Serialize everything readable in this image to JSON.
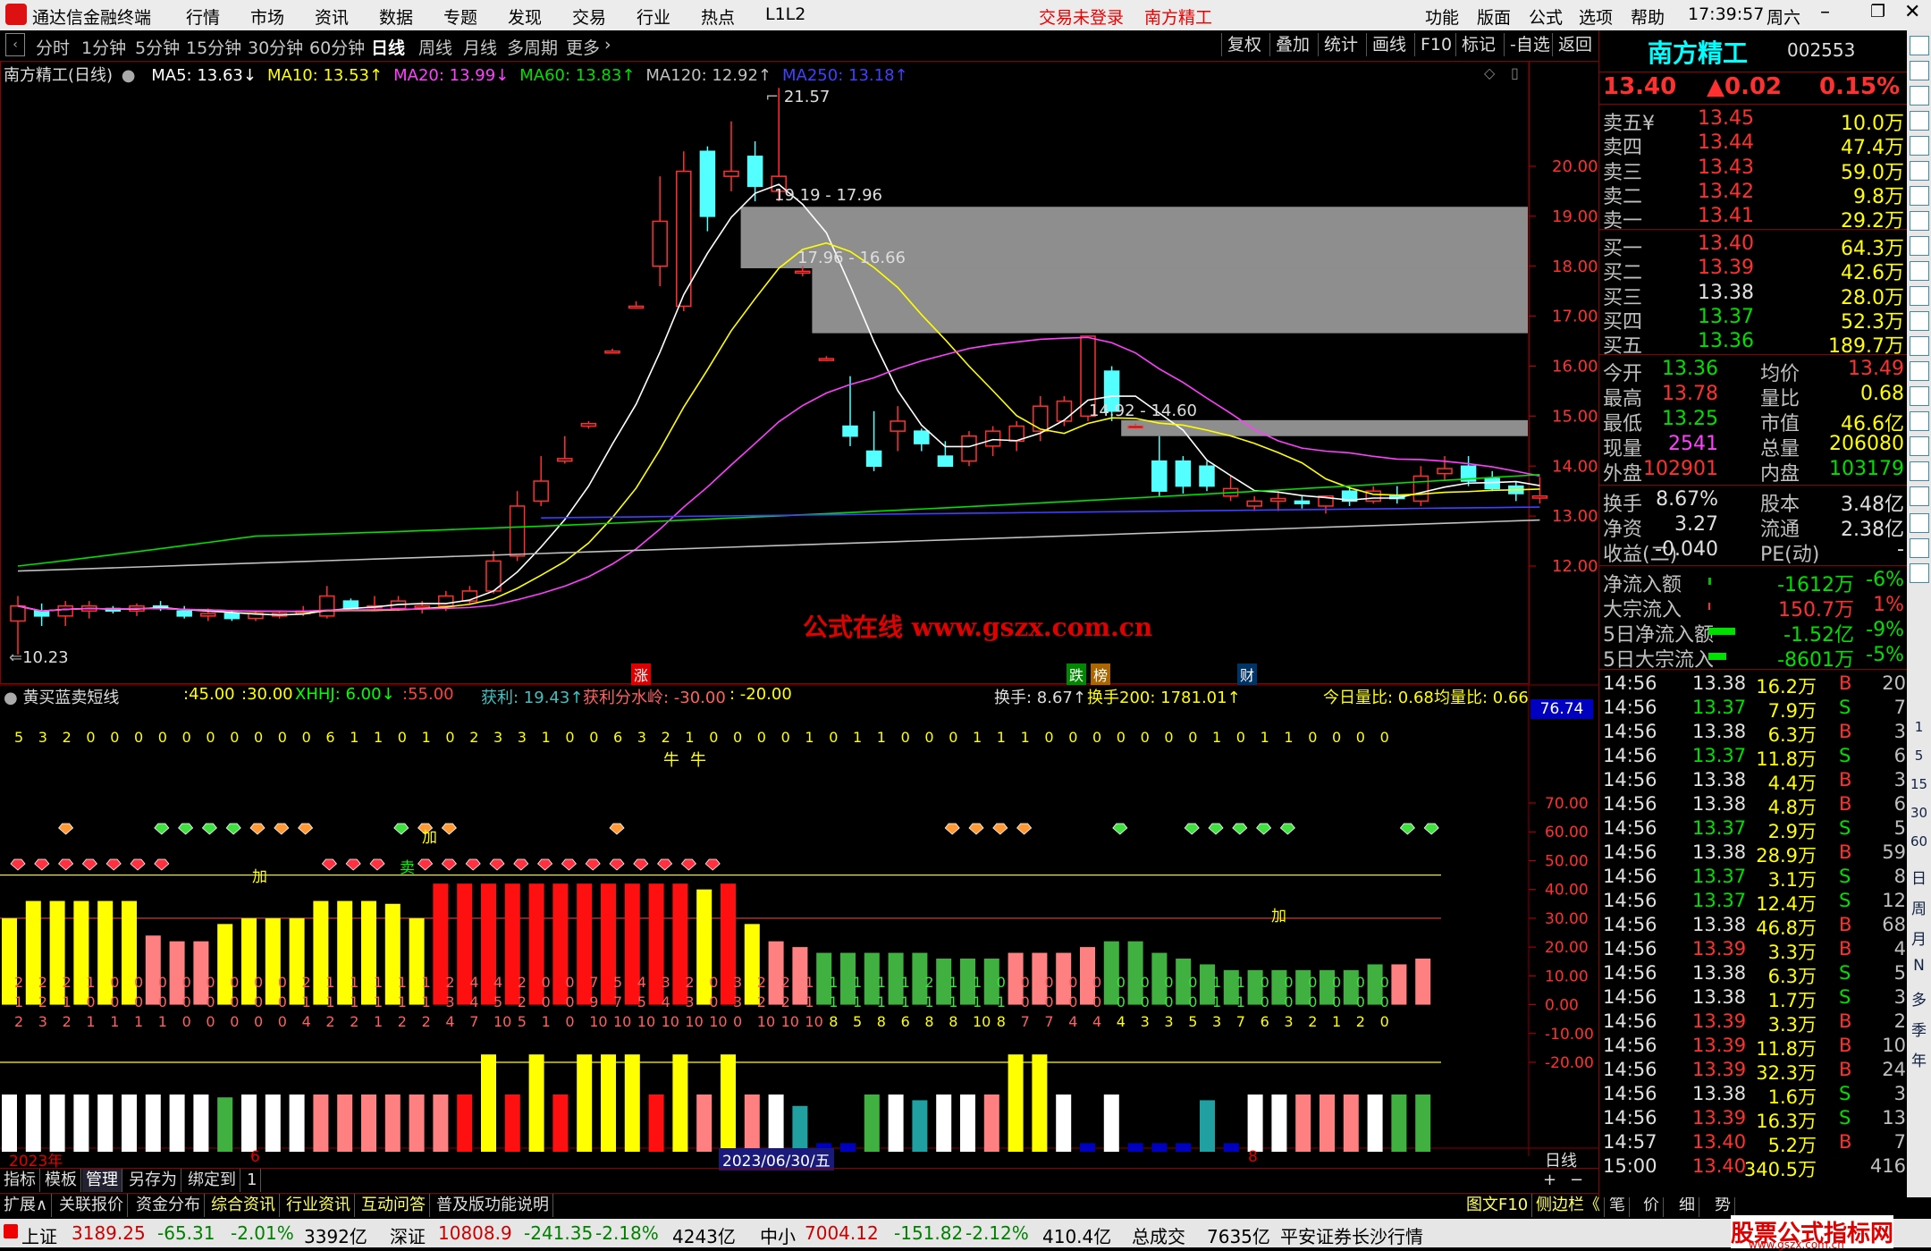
{
  "titlebar": {
    "app_title": "通达信金融终端",
    "menu": [
      "行情",
      "市场",
      "资讯",
      "数据",
      "专题",
      "发现",
      "交易",
      "行业",
      "热点",
      "L1L2"
    ],
    "trade_status": "交易未登录",
    "stock_name": "南方精工",
    "right_menu": [
      "功能",
      "版面",
      "公式",
      "选项",
      "帮助"
    ],
    "time": "17:39:57",
    "weekday": "周六"
  },
  "toolbar": {
    "periods": [
      "分时",
      "1分钟",
      "5分钟",
      "15分钟",
      "30分钟",
      "60分钟",
      "日线",
      "周线",
      "月线",
      "多周期",
      "更多"
    ],
    "active_period": "日线",
    "right_buttons": [
      "复权",
      "叠加",
      "统计",
      "画线",
      "F10",
      "标记",
      "-自选",
      "返回"
    ]
  },
  "main_chart": {
    "header": "南方精工(日线)",
    "ma": [
      {
        "label": "MA5: 13.63↓",
        "color": "#ffffff"
      },
      {
        "label": "MA10: 13.53↑",
        "color": "#ffff00"
      },
      {
        "label": "MA20: 13.99↓",
        "color": "#ff40ff"
      },
      {
        "label": "MA60: 13.83↑",
        "color": "#00e000"
      },
      {
        "label": "MA120: 12.92↑",
        "color": "#c0c0c0"
      },
      {
        "label": "MA250: 13.18↑",
        "color": "#4040ff"
      }
    ],
    "high_label": "21.57",
    "low_label": "10.23",
    "gap_labels": [
      "19.19 - 17.96",
      "17.96 - 16.66",
      "14.92 - 14.60"
    ],
    "price_axis": [
      "20.00",
      "19.00",
      "18.00",
      "17.00",
      "16.00",
      "15.00",
      "14.00",
      "13.00",
      "12.00"
    ],
    "watermark": "公式在线  www.gszx.com.cn",
    "event_tags": [
      "涨",
      "跌",
      "榜",
      "财"
    ]
  },
  "indicator": {
    "name": "黄买蓝卖短线",
    "params": [
      ":45.00",
      ":30.00",
      "XHHJ: 6.00↓",
      ":55.00",
      "获利: 19.43↑",
      "获利分水岭: -30.00",
      ": -20.00",
      "换手: 8.67↑",
      "换手200: 1781.01↑",
      "今日量比: 0.68",
      "均量比: 0.66"
    ],
    "axis": [
      "70.00",
      "60.00",
      "50.00",
      "40.00",
      "30.00",
      "20.00",
      "10.00",
      "0.00",
      "-10.00",
      "-20.00"
    ],
    "axis_box": "76.74",
    "digit_row": [
      "5",
      "3",
      "2",
      "0",
      "0",
      "0",
      "0",
      "0",
      "0",
      "0",
      "0",
      "0",
      "0",
      "6",
      "1",
      "1",
      "0",
      "1",
      "0",
      "2",
      "3",
      "3",
      "1",
      "0",
      "0",
      "6",
      "3",
      "2",
      "1",
      "0",
      "0",
      "0",
      "0",
      "1",
      "0",
      "1",
      "1",
      "0",
      "0",
      "0",
      "1",
      "1",
      "1",
      "0",
      "0",
      "0",
      "0",
      "0",
      "0",
      "0",
      "1",
      "0",
      "1",
      "1",
      "0",
      "0",
      "0",
      "0"
    ],
    "small_digits_1": [
      "2",
      "2",
      "2",
      "1",
      "0",
      "0",
      "0",
      "0",
      "0",
      "0",
      "0",
      "0",
      "2",
      "1",
      "1",
      "1",
      "1",
      "1",
      "2",
      "4",
      "4",
      "2",
      "0",
      "0",
      "7",
      "5",
      "4",
      "3",
      "2",
      "0",
      "3",
      "2",
      "2",
      "1",
      "1",
      "1",
      "1",
      "1",
      "2",
      "1",
      "1",
      "0",
      "0",
      "0",
      "0",
      "0",
      "0",
      "0",
      "0",
      "0",
      "1",
      "1",
      "0",
      "0",
      "0",
      "0",
      "0",
      "0"
    ],
    "small_digits_2": [
      "1",
      "2",
      "1",
      "0",
      "0",
      "0",
      "0",
      "0",
      "0",
      "0",
      "0",
      "0",
      "1",
      "1",
      "1",
      "1",
      "1",
      "1",
      "3",
      "4",
      "5",
      "2",
      "0",
      "0",
      "9",
      "7",
      "5",
      "4",
      "3",
      "0",
      "3",
      "2",
      "2",
      "1",
      "1",
      "1",
      "1",
      "1",
      "1",
      "1",
      "1",
      "1",
      "0",
      "0",
      "0",
      "0",
      "0",
      "0",
      "0",
      "0",
      "1",
      "1",
      "0",
      "0",
      "0",
      "0",
      "0",
      "0"
    ],
    "small_digits_3": [
      "2",
      "3",
      "2",
      "1",
      "1",
      "1",
      "1",
      "0",
      "0",
      "0",
      "0",
      "0",
      "4",
      "2",
      "2",
      "1",
      "2",
      "2",
      "4",
      "7",
      "10",
      "5",
      "1",
      "0",
      "10",
      "10",
      "10",
      "10",
      "10",
      "10",
      "0",
      "10",
      "10",
      "10",
      "8",
      "5",
      "8",
      "6",
      "8",
      "8",
      "10",
      "8",
      "7",
      "7",
      "4",
      "4",
      "4",
      "3",
      "3",
      "5",
      "3",
      "7",
      "6",
      "3",
      "2",
      "1",
      "2",
      "0"
    ],
    "mark_jia": "加",
    "mark_niu": "牛",
    "mark_mai": "卖"
  },
  "bottom_axis": {
    "year_label": "2023年",
    "month_1": "6",
    "cursor_date": "2023/06/30/五",
    "month_2": "8",
    "period_label": "日线"
  },
  "bottom_tabs_1": [
    "指标",
    "模板",
    "管理",
    "另存为",
    "绑定到",
    "1"
  ],
  "bottom_tabs_2": [
    "扩展∧",
    "关联报价",
    "资金分布",
    "综合资讯",
    "行业资讯",
    "互动问答",
    "普及版功能说明"
  ],
  "bottom_tabs_right": [
    "图文F10",
    "侧边栏《",
    "笔",
    "价",
    "细",
    "势"
  ],
  "quote": {
    "name": "南方精工",
    "code": "002553",
    "price": "13.40",
    "change": "▲0.02",
    "pct": "0.15%",
    "asks": [
      {
        "label": "卖五",
        "price": "13.45",
        "vol": "10.0万"
      },
      {
        "label": "卖四",
        "price": "13.44",
        "vol": "47.4万"
      },
      {
        "label": "卖三",
        "price": "13.43",
        "vol": "59.0万"
      },
      {
        "label": "卖二",
        "price": "13.42",
        "vol": "9.8万"
      },
      {
        "label": "卖一",
        "price": "13.41",
        "vol": "29.2万"
      }
    ],
    "bids": [
      {
        "label": "买一",
        "price": "13.40",
        "vol": "64.3万"
      },
      {
        "label": "买二",
        "price": "13.39",
        "vol": "42.6万"
      },
      {
        "label": "买三",
        "price": "13.38",
        "vol": "28.0万"
      },
      {
        "label": "买四",
        "price": "13.37",
        "vol": "52.3万"
      },
      {
        "label": "买五",
        "price": "13.36",
        "vol": "189.7万"
      }
    ],
    "stats": [
      [
        "今开",
        "13.36",
        "均价",
        "13.49"
      ],
      [
        "最高",
        "13.78",
        "量比",
        "0.68"
      ],
      [
        "最低",
        "13.25",
        "市值",
        "46.6亿"
      ],
      [
        "现量",
        "2541",
        "总量",
        "206080"
      ],
      [
        "外盘",
        "102901",
        "内盘",
        "103179"
      ]
    ],
    "stats2": [
      [
        "换手",
        "8.67%",
        "股本",
        "3.48亿"
      ],
      [
        "净资",
        "3.27",
        "流通",
        "2.38亿"
      ],
      [
        "收益(二)",
        "-0.040",
        "PE(动)",
        "-"
      ]
    ],
    "flows": [
      [
        "净流入额",
        "-1612万",
        "-6%"
      ],
      [
        "大宗流入",
        "150.7万",
        "1%"
      ],
      [
        "5日净流入额",
        "-1.52亿",
        "-9%"
      ],
      [
        "5日大宗流入",
        "-8601万",
        "-5%"
      ]
    ],
    "ticks": [
      [
        "14:56",
        "13.38",
        "16.2万",
        "B",
        "20"
      ],
      [
        "14:56",
        "13.37",
        "7.9万",
        "S",
        "7"
      ],
      [
        "14:56",
        "13.38",
        "6.3万",
        "B",
        "3"
      ],
      [
        "14:56",
        "13.37",
        "11.8万",
        "S",
        "6"
      ],
      [
        "14:56",
        "13.38",
        "4.4万",
        "B",
        "3"
      ],
      [
        "14:56",
        "13.38",
        "4.8万",
        "B",
        "6"
      ],
      [
        "14:56",
        "13.37",
        "2.9万",
        "S",
        "5"
      ],
      [
        "14:56",
        "13.38",
        "28.9万",
        "B",
        "59"
      ],
      [
        "14:56",
        "13.37",
        "3.1万",
        "S",
        "8"
      ],
      [
        "14:56",
        "13.37",
        "12.4万",
        "S",
        "12"
      ],
      [
        "14:56",
        "13.38",
        "46.8万",
        "B",
        "68"
      ],
      [
        "14:56",
        "13.39",
        "3.3万",
        "B",
        "4"
      ],
      [
        "14:56",
        "13.38",
        "6.3万",
        "S",
        "5"
      ],
      [
        "14:56",
        "13.38",
        "1.7万",
        "S",
        "3"
      ],
      [
        "14:56",
        "13.39",
        "3.3万",
        "B",
        "2"
      ],
      [
        "14:56",
        "13.39",
        "11.8万",
        "B",
        "10"
      ],
      [
        "14:56",
        "13.39",
        "32.3万",
        "B",
        "24"
      ],
      [
        "14:56",
        "13.38",
        "1.6万",
        "S",
        "3"
      ],
      [
        "14:56",
        "13.39",
        "16.3万",
        "S",
        "13"
      ],
      [
        "14:57",
        "13.40",
        "5.2万",
        "B",
        "7"
      ],
      [
        "15:00",
        "13.40",
        "340.5万",
        "",
        "416"
      ]
    ]
  },
  "side_periods": [
    "日",
    "周",
    "月",
    "N",
    "多",
    "季",
    "年"
  ],
  "side_minutes": [
    "1",
    "5",
    "15",
    "30",
    "60"
  ],
  "statusbar": {
    "items": [
      {
        "name": "上证",
        "val": "3189.25",
        "chg": "-65.31",
        "pct": "-2.01%",
        "amt": "3392亿"
      },
      {
        "name": "深证",
        "val": "10808.9",
        "chg": "-241.35",
        "pct": "-2.18%",
        "amt": "4243亿"
      },
      {
        "name": "中小",
        "val": "7004.12",
        "chg": "-151.82",
        "pct": "-2.12%",
        "amt": "410.4亿"
      }
    ],
    "total_label": "总成交",
    "total_val": "7635亿",
    "broker": "平安证券长沙行情",
    "site_logo": "股票公式指标网",
    "site_url": "www.gszx.com.cn"
  },
  "colors": {
    "up": "#ff3030",
    "down": "#00c000",
    "cyan": "#54ffff",
    "yellow": "#ffff00",
    "frame": "#800000"
  },
  "candles": [
    {
      "o": 10.9,
      "h": 11.4,
      "l": 10.23,
      "c": 11.2
    },
    {
      "o": 11.1,
      "h": 11.25,
      "l": 10.8,
      "c": 11.0
    },
    {
      "o": 11.0,
      "h": 11.3,
      "l": 10.8,
      "c": 11.2
    },
    {
      "o": 11.1,
      "h": 11.3,
      "l": 10.95,
      "c": 11.2
    },
    {
      "o": 11.15,
      "h": 11.2,
      "l": 11.05,
      "c": 11.1
    },
    {
      "o": 11.1,
      "h": 11.25,
      "l": 11.0,
      "c": 11.2
    },
    {
      "o": 11.2,
      "h": 11.3,
      "l": 11.1,
      "c": 11.15
    },
    {
      "o": 11.1,
      "h": 11.2,
      "l": 10.95,
      "c": 11.0
    },
    {
      "o": 11.0,
      "h": 11.15,
      "l": 10.9,
      "c": 11.05
    },
    {
      "o": 11.05,
      "h": 11.1,
      "l": 10.9,
      "c": 10.95
    },
    {
      "o": 10.95,
      "h": 11.1,
      "l": 10.9,
      "c": 11.05
    },
    {
      "o": 11.0,
      "h": 11.1,
      "l": 10.95,
      "c": 11.05
    },
    {
      "o": 11.05,
      "h": 11.2,
      "l": 11.0,
      "c": 11.1
    },
    {
      "o": 11.0,
      "h": 11.6,
      "l": 10.95,
      "c": 11.4
    },
    {
      "o": 11.3,
      "h": 11.35,
      "l": 11.1,
      "c": 11.15
    },
    {
      "o": 11.2,
      "h": 11.4,
      "l": 11.1,
      "c": 11.2
    },
    {
      "o": 11.15,
      "h": 11.4,
      "l": 11.1,
      "c": 11.3
    },
    {
      "o": 11.2,
      "h": 11.3,
      "l": 11.05,
      "c": 11.2
    },
    {
      "o": 11.2,
      "h": 11.5,
      "l": 11.1,
      "c": 11.4
    },
    {
      "o": 11.3,
      "h": 11.6,
      "l": 11.25,
      "c": 11.5
    },
    {
      "o": 11.5,
      "h": 12.3,
      "l": 11.45,
      "c": 12.1
    },
    {
      "o": 12.2,
      "h": 13.5,
      "l": 12.1,
      "c": 13.2
    },
    {
      "o": 13.3,
      "h": 14.2,
      "l": 13.2,
      "c": 13.7
    },
    {
      "o": 14.1,
      "h": 14.6,
      "l": 14.05,
      "c": 14.15
    },
    {
      "o": 14.8,
      "h": 14.9,
      "l": 14.75,
      "c": 14.85
    },
    {
      "o": 16.3,
      "h": 16.35,
      "l": 16.25,
      "c": 16.3
    },
    {
      "o": 17.2,
      "h": 17.3,
      "l": 17.15,
      "c": 17.2
    },
    {
      "o": 18.0,
      "h": 19.8,
      "l": 17.6,
      "c": 18.9
    },
    {
      "o": 17.2,
      "h": 20.3,
      "l": 17.1,
      "c": 19.9
    },
    {
      "o": 20.3,
      "h": 20.4,
      "l": 18.7,
      "c": 19.0
    },
    {
      "o": 19.8,
      "h": 20.9,
      "l": 19.5,
      "c": 19.9
    },
    {
      "o": 20.2,
      "h": 20.5,
      "l": 19.3,
      "c": 19.6
    },
    {
      "o": 19.5,
      "h": 21.57,
      "l": 19.3,
      "c": 19.8
    },
    {
      "o": 17.9,
      "h": 18.0,
      "l": 17.8,
      "c": 17.9
    },
    {
      "o": 16.15,
      "h": 16.2,
      "l": 16.1,
      "c": 16.15
    },
    {
      "o": 14.8,
      "h": 15.8,
      "l": 14.4,
      "c": 14.6
    },
    {
      "o": 14.3,
      "h": 15.1,
      "l": 13.9,
      "c": 14.0
    },
    {
      "o": 14.7,
      "h": 15.2,
      "l": 14.3,
      "c": 14.9
    },
    {
      "o": 14.7,
      "h": 14.75,
      "l": 14.3,
      "c": 14.45
    },
    {
      "o": 14.2,
      "h": 14.5,
      "l": 14.1,
      "c": 14.0
    },
    {
      "o": 14.1,
      "h": 14.7,
      "l": 14.0,
      "c": 14.6
    },
    {
      "o": 14.4,
      "h": 14.8,
      "l": 14.2,
      "c": 14.7
    },
    {
      "o": 14.5,
      "h": 14.9,
      "l": 14.3,
      "c": 14.8
    },
    {
      "o": 14.7,
      "h": 15.4,
      "l": 14.5,
      "c": 15.2
    },
    {
      "o": 14.9,
      "h": 15.4,
      "l": 14.8,
      "c": 15.3
    },
    {
      "o": 15.0,
      "h": 16.6,
      "l": 14.9,
      "c": 16.6
    },
    {
      "o": 15.9,
      "h": 16.0,
      "l": 14.9,
      "c": 15.1
    },
    {
      "o": 14.8,
      "h": 14.85,
      "l": 14.75,
      "c": 14.8
    },
    {
      "o": 14.1,
      "h": 14.6,
      "l": 13.4,
      "c": 13.5
    },
    {
      "o": 14.1,
      "h": 14.2,
      "l": 13.45,
      "c": 13.6
    },
    {
      "o": 14.0,
      "h": 14.1,
      "l": 13.5,
      "c": 13.6
    },
    {
      "o": 13.4,
      "h": 13.8,
      "l": 13.3,
      "c": 13.55
    },
    {
      "o": 13.2,
      "h": 13.4,
      "l": 13.1,
      "c": 13.3
    },
    {
      "o": 13.3,
      "h": 13.5,
      "l": 13.1,
      "c": 13.35
    },
    {
      "o": 13.3,
      "h": 13.4,
      "l": 13.15,
      "c": 13.25
    },
    {
      "o": 13.2,
      "h": 13.4,
      "l": 13.05,
      "c": 13.4
    },
    {
      "o": 13.5,
      "h": 13.6,
      "l": 13.2,
      "c": 13.3
    },
    {
      "o": 13.3,
      "h": 13.6,
      "l": 13.25,
      "c": 13.5
    },
    {
      "o": 13.4,
      "h": 13.6,
      "l": 13.25,
      "c": 13.35
    },
    {
      "o": 13.3,
      "h": 14.0,
      "l": 13.2,
      "c": 13.8
    },
    {
      "o": 13.85,
      "h": 14.2,
      "l": 13.7,
      "c": 13.95
    },
    {
      "o": 14.0,
      "h": 14.2,
      "l": 13.6,
      "c": 13.7
    },
    {
      "o": 13.75,
      "h": 13.9,
      "l": 13.5,
      "c": 13.55
    },
    {
      "o": 13.6,
      "h": 13.7,
      "l": 13.3,
      "c": 13.45
    },
    {
      "o": 13.36,
      "h": 13.78,
      "l": 13.25,
      "c": 13.4
    }
  ]
}
